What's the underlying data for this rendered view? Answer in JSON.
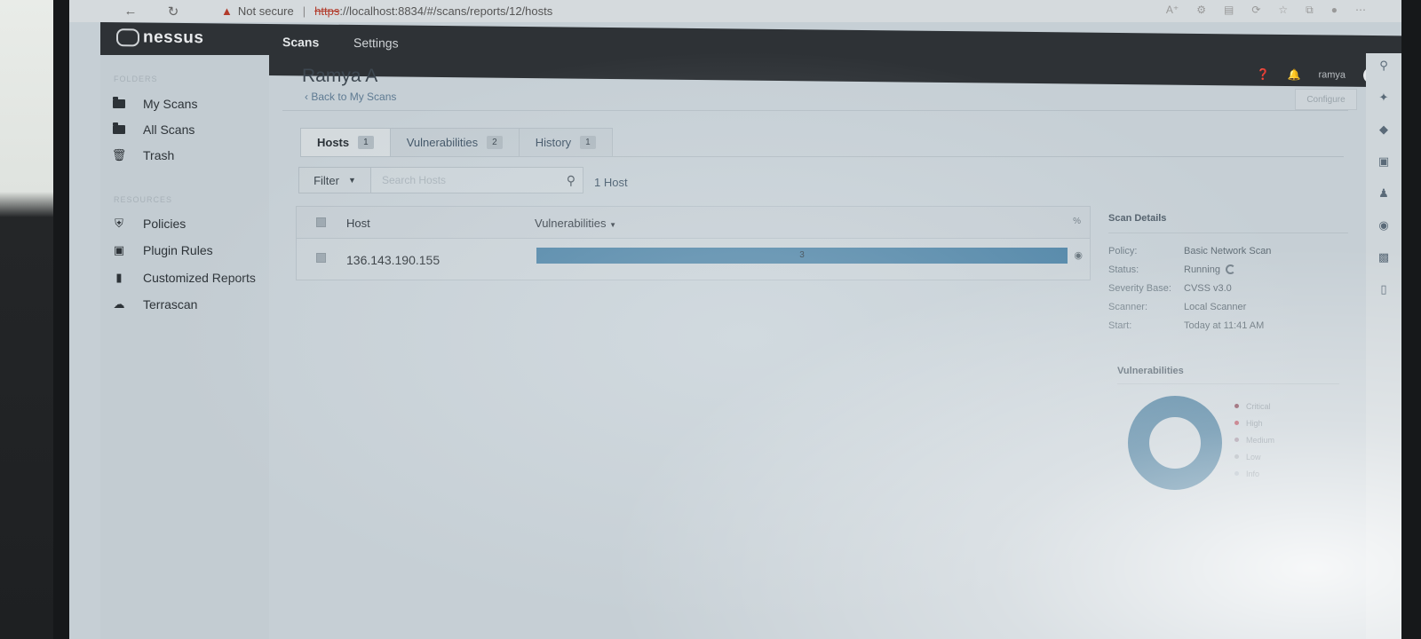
{
  "browser": {
    "not_secure": "Not secure",
    "url_scheme": "https",
    "url_rest": "://localhost:8834/#/scans/reports/12/hosts"
  },
  "app": {
    "logo": "nessus",
    "nav": [
      "Scans",
      "Settings"
    ],
    "user": "ramya"
  },
  "sidebar": {
    "folders_label": "FOLDERS",
    "folders": [
      "My Scans",
      "All Scans",
      "Trash"
    ],
    "resources_label": "RESOURCES",
    "resources": [
      "Policies",
      "Plugin Rules",
      "Customized Reports",
      "Terrascan"
    ]
  },
  "page": {
    "title": "Ramya A",
    "back_link": "Back to My Scans",
    "configure": "Configure"
  },
  "tabs": [
    {
      "label": "Hosts",
      "count": "1"
    },
    {
      "label": "Vulnerabilities",
      "count": "2"
    },
    {
      "label": "History",
      "count": "1"
    }
  ],
  "filter": {
    "label": "Filter",
    "search_placeholder": "Search Hosts",
    "host_count": "1 Host"
  },
  "table": {
    "col_host": "Host",
    "col_vulns": "Vulnerabilities",
    "col_pct": "%",
    "rows": [
      {
        "host": "136.143.190.155",
        "vuln_count": "3",
        "bar_fraction": 1.0
      }
    ]
  },
  "scan_details": {
    "title": "Scan Details",
    "rows": [
      {
        "label": "Policy:",
        "value": "Basic Network Scan"
      },
      {
        "label": "Status:",
        "value": "Running"
      },
      {
        "label": "Severity Base:",
        "value": "CVSS v3.0"
      },
      {
        "label": "Scanner:",
        "value": "Local Scanner"
      },
      {
        "label": "Start:",
        "value": "Today at 11:41 AM"
      }
    ]
  },
  "vuln_chart": {
    "title": "Vulnerabilities",
    "legend": [
      {
        "name": "Critical",
        "color": "#7a3a4a"
      },
      {
        "name": "High",
        "color": "#b04a5a"
      },
      {
        "name": "Medium",
        "color": "#9a8a9a"
      },
      {
        "name": "Low",
        "color": "#a0a8b0"
      },
      {
        "name": "Info",
        "color": "#a8b4bf"
      }
    ],
    "donut_color": "#3d7395"
  }
}
